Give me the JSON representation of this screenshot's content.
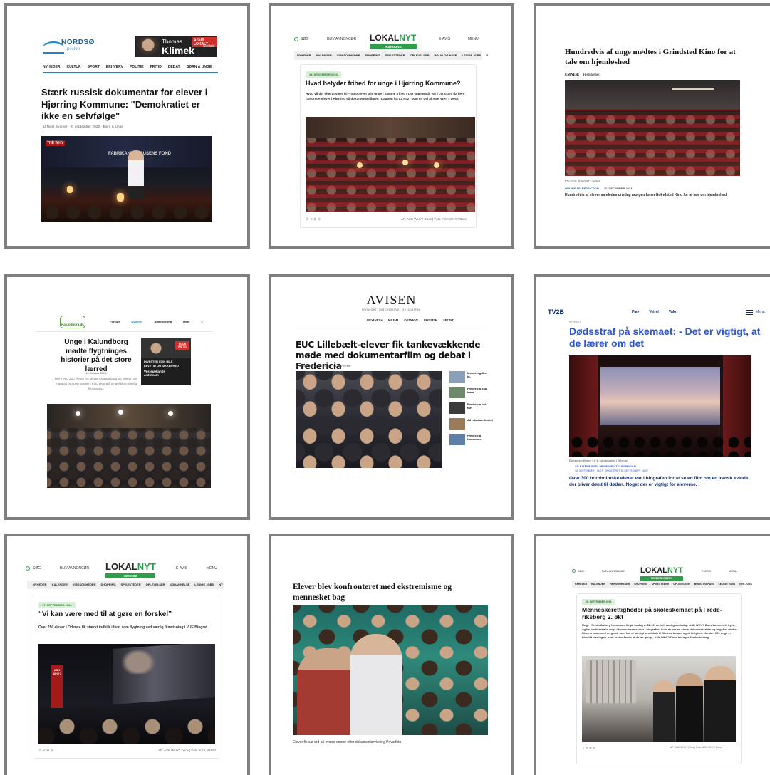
{
  "tiles": {
    "t1": {
      "logo": "NORDSØ",
      "logo_sub": "posten",
      "ad_name_small": "Thomas",
      "ad_name_big": "Klimek",
      "ad_badge": "STEM LOKALT",
      "ad_party": "Sociald",
      "nav": [
        "NYHEDER",
        "KULTUR",
        "SPORT",
        "ERHVERV",
        "POLITIK",
        "FRITID",
        "DEBAT",
        "BØRN & UNGE"
      ],
      "headline": "Stærk russisk dokumentar for elever i Hjørring Kommune: \"Demokratiet er ikke en selvfølge\"",
      "byline": "af Niels Skipper · 4. september 2023 · Børn & Unge",
      "stage_text": "FABRIKANT   CLAUSENS FOND",
      "stage_left": "THE WHY"
    },
    "t2": {
      "search": "SØG",
      "buy": "BLIV ANNONCØR",
      "logo_a": "LOKAL",
      "logo_b": "NYT",
      "region": "HJØRRING",
      "eavis": "E-AVIS",
      "menu": "MENU",
      "nav": [
        "NYHEDER",
        "KALENDER",
        "VIRKSOMHEDER",
        "SHOPPING",
        "SPISESTEDER",
        "OPLEVELSER",
        "BOLIG OG HAVE",
        "LEDIGE JOBS",
        "N"
      ],
      "date": "24. NOVEMBER 2023",
      "headline": "Hvad betyder frihed for unge i Hjørring Kommune?",
      "lead": "Hvad vil det sige at være fri – og oplever alle unge i samme frihed? Det spørgsmål var i centrum, da flere hundrede elever i Hjørring så dokumentarfilmen \"Dagbog fra La Paz\" som en del af ASK WHY? Docs.",
      "credit": "AF: ASK WHY? Docs | Foto: ASK WHY? Docs"
    },
    "t3": {
      "headline": "Hundredvis af unge mødtes i Grindsted Kino for at tale om hjemløshed",
      "topics_label": "EMNER:",
      "topics_value": "Hjemløshed",
      "photo_credit": "PR-Foto: ASKWHY?Docs",
      "byline": "ONLINE AF: REDAKTION",
      "date": "20. DECEMBER 2023",
      "caption": "Hundredvis af elever samledes onsdag morgen foran Griindsted Kino for at tale om hjemløshed."
    },
    "t4": {
      "logo": "Kalundborg.dk",
      "nav": [
        "Forside",
        "Nyheder",
        "Annoncering",
        "Mere"
      ],
      "headline": "Unge i Kalundborg mødte flygtninges historier på det store lærred",
      "date": "10. februar 2024",
      "lead": "Mere end 200 elever fra skoler i Kalundborg og omegn var mandag morgen samlet i Kino Den Blå Engel til en særlig filmvisning.",
      "ad_line1": "INVESTER I DIN BILS",
      "ad_line2": "LEVETID OG SIKKERHED",
      "ad_brand": "Vestsjællands Autoteam",
      "ad_badge": "BOOK EN TID"
    },
    "t5": {
      "masthead": "AVISEN",
      "tagline": "Nyheder, perspektiver og analyse",
      "nav": [
        "BUSINESS",
        "KRIMI",
        "OPINION",
        "POLITIK",
        "SPORT"
      ],
      "headline": "EUC Lillebælt-elever fik tankevækkende møde med dokumentarfilm og debat i Fredericia",
      "byline": "af Mille Rydeberg · 2024 · 15 november",
      "sidebar": [
        "Motorist griber in-",
        "Fredericia skal bada",
        "Fredericia har fået",
        "Advokatsamfundet",
        "Fredericia Kommune"
      ]
    },
    "t6": {
      "logo": "TV2B",
      "nav": [
        "Play",
        "Vejret",
        "Valg"
      ],
      "menu": "Menu",
      "kicker": "NYHEDER",
      "headline": "Dødsstraf på skemaet: - Det er vigtigt, at de lærer om det",
      "caption": "Eleven ser filmen 'Lit' ik og dødsstraf i Teheran",
      "byline1": "AF: KATRINE BUTH JØRGENSEN, TV2 BORNHOLM",
      "byline2": "30. SEPTEMBER · 16:07 · OPDATERET 30 SEPTEMBER · 16:07",
      "lead": "Over 300 bornholmske elever var i biografen for at se en film om en iransk kvinde, der bliver dømt til døden. Noget der er vigtigt for eleverne."
    },
    "t7": {
      "search": "SØG",
      "buy": "BLIV ANNONCØR",
      "logo_a": "LOKAL",
      "logo_b": "NYT",
      "region": "ODENSE",
      "eavis": "E-AVIS",
      "menu": "MENU",
      "nav": [
        "NYHEDER",
        "KALENDER",
        "VIRKSOMHEDER",
        "SHOPPING",
        "SPISESTEDER",
        "OPLEVELSER",
        "UDDANNELSE",
        "LEDIGE JOBS",
        "NY"
      ],
      "date": "17. SEPTEMBER 2024",
      "headline": "“Vi kan være med til at gøre en forskel”",
      "lead": "Over 250 elever i Odense fik stærkt indblik i livet som flygtning ved særlig filmvisning i VUE Biograf.",
      "credit": "AF: ASK WHY? Docs | Foto: ASK WHY?",
      "banner": "ASK WHY?"
    },
    "t8": {
      "headline": "Elever blev konfronteret med ekstremisme og mennesket bag",
      "caption": "Elever fik sat ord på svære emner efter dokumentarvisning Privatfoto"
    },
    "t9": {
      "search": "SØG",
      "buy": "BLIV ANNONCØR",
      "logo_a": "LOKAL",
      "logo_b": "NYT",
      "region": "FREDERIKSBERG",
      "eavis": "E-AVIS",
      "menu": "MENU",
      "nav": [
        "NYHEDER",
        "KALENDER",
        "VIRKSOMHEDER",
        "SHOPPING",
        "SPISESTEDER",
        "OPLEVELSER",
        "BOLIG OG HAVE",
        "LEDIGE JOBS",
        "NYE JOBS"
      ],
      "date": "26. SEPTEMBER 2024",
      "headline": "Menneskerettigheder på skoleskemaet på Frede- riksberg 2. økt",
      "lead": "Unge i Frederiksberg Kommune fik på fordag d. 02.10. en helt særlig skoledag. ASK WHY? Docs kommer til byen, og har inviteret alle unge i kommunens skoler i biografen, hvor de ser en stærk dokumentarfilm og bagefter drøfter filmens tema med en gæst, som har et særligt kendskab til filmens temaer og virkelighed. Næsten 200 unge er tilmeldt visningen, som er den første af de tre gange, ASK WHY? Docs besøger Frederiksberg.",
      "credit": "AF: ASK WHY? Docs | Foto: ASK WHY? Docs"
    }
  },
  "colors": {
    "frame": "#7f7f7f",
    "lokalnyt_green": "#2e9e4a",
    "tv2_blue": "#2a56d6",
    "nordso_red": "#d0312d"
  }
}
